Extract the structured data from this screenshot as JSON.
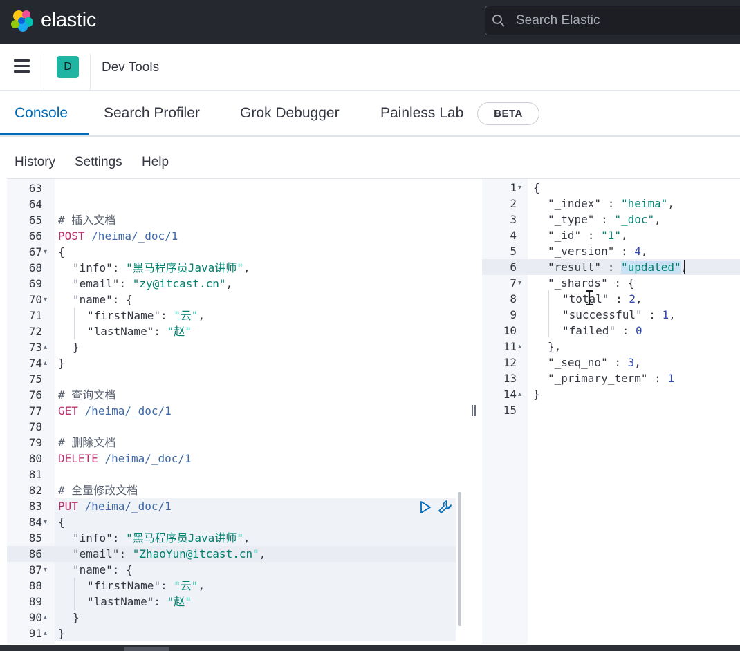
{
  "header": {
    "brand": "elastic",
    "search_placeholder": "Search Elastic"
  },
  "breadcrumb": {
    "avatar_letter": "D",
    "title": "Dev Tools"
  },
  "tabs": [
    {
      "label": "Console",
      "active": true
    },
    {
      "label": "Search Profiler",
      "active": false
    },
    {
      "label": "Grok Debugger",
      "active": false
    },
    {
      "label": "Painless Lab",
      "active": false
    }
  ],
  "beta_badge": "BETA",
  "console_menu": [
    "History",
    "Settings",
    "Help"
  ],
  "request_editor": {
    "lines": [
      {
        "n": "63",
        "text": ""
      },
      {
        "n": "64",
        "text": ""
      },
      {
        "n": "65",
        "text": "# 插入文档"
      },
      {
        "n": "66",
        "method": "POST",
        "url": "/heima/_doc/1"
      },
      {
        "n": "67",
        "text": "{",
        "fold": "▾"
      },
      {
        "n": "68",
        "key": "\"info\"",
        "value": "\"黑马程序员Java讲师\"",
        "tail": ","
      },
      {
        "n": "69",
        "key": "\"email\"",
        "value": "\"zy@itcast.cn\"",
        "tail": ","
      },
      {
        "n": "70",
        "key": "\"name\"",
        "value": "{",
        "fold": "▾"
      },
      {
        "n": "71",
        "key": "\"firstName\"",
        "value": "\"云\"",
        "tail": ","
      },
      {
        "n": "72",
        "key": "\"lastName\"",
        "value": "\"赵\""
      },
      {
        "n": "73",
        "text": "}",
        "fold": "▴"
      },
      {
        "n": "74",
        "text": "}",
        "fold": "▴"
      },
      {
        "n": "75",
        "text": ""
      },
      {
        "n": "76",
        "text": "# 查询文档"
      },
      {
        "n": "77",
        "method": "GET",
        "url": "/heima/_doc/1"
      },
      {
        "n": "78",
        "text": ""
      },
      {
        "n": "79",
        "text": "# 删除文档"
      },
      {
        "n": "80",
        "method": "DELETE",
        "url": "/heima/_doc/1"
      },
      {
        "n": "81",
        "text": ""
      },
      {
        "n": "82",
        "text": "# 全量修改文档"
      },
      {
        "n": "83",
        "method": "PUT",
        "url": "/heima/_doc/1"
      },
      {
        "n": "84",
        "text": "{",
        "fold": "▾"
      },
      {
        "n": "85",
        "key": "\"info\"",
        "value": "\"黑马程序员Java讲师\"",
        "tail": ","
      },
      {
        "n": "86",
        "key": "\"email\"",
        "value": "\"ZhaoYun@itcast.cn\"",
        "tail": ","
      },
      {
        "n": "87",
        "key": "\"name\"",
        "value": "{",
        "fold": "▾"
      },
      {
        "n": "88",
        "key": "\"firstName\"",
        "value": "\"云\"",
        "tail": ","
      },
      {
        "n": "89",
        "key": "\"lastName\"",
        "value": "\"赵\""
      },
      {
        "n": "90",
        "text": "}",
        "fold": "▴"
      },
      {
        "n": "91",
        "text": "}",
        "fold": "▴"
      }
    ]
  },
  "response_editor": {
    "lines": [
      {
        "n": "1",
        "text": "{",
        "fold": "▾"
      },
      {
        "n": "2",
        "key": "\"_index\"",
        "value": "\"heima\"",
        "tail": ","
      },
      {
        "n": "3",
        "key": "\"_type\"",
        "value": "\"_doc\"",
        "tail": ","
      },
      {
        "n": "4",
        "key": "\"_id\"",
        "value": "\"1\"",
        "tail": ","
      },
      {
        "n": "5",
        "key": "\"_version\"",
        "value": "4",
        "tail": ","
      },
      {
        "n": "6",
        "key": "\"result\"",
        "value": "\"updated\"",
        "tail": ","
      },
      {
        "n": "7",
        "key": "\"_shards\"",
        "value": "{",
        "fold": "▾"
      },
      {
        "n": "8",
        "key": "\"total\"",
        "value": "2",
        "tail": ","
      },
      {
        "n": "9",
        "key": "\"successful\"",
        "value": "1",
        "tail": ","
      },
      {
        "n": "10",
        "key": "\"failed\"",
        "value": "0"
      },
      {
        "n": "11",
        "text": "},",
        "fold": "▴"
      },
      {
        "n": "12",
        "key": "\"_seq_no\"",
        "value": "3",
        "tail": ","
      },
      {
        "n": "13",
        "key": "\"_primary_term\"",
        "value": "1"
      },
      {
        "n": "14",
        "text": "}",
        "fold": "▴"
      },
      {
        "n": "15",
        "text": ""
      }
    ]
  },
  "colors": {
    "accent": "#006bb8",
    "header_bg": "#25282f",
    "avatar_bg": "#20b4a3",
    "method": "#b9306a",
    "string": "#00806f",
    "number": "#2f4ab3"
  }
}
